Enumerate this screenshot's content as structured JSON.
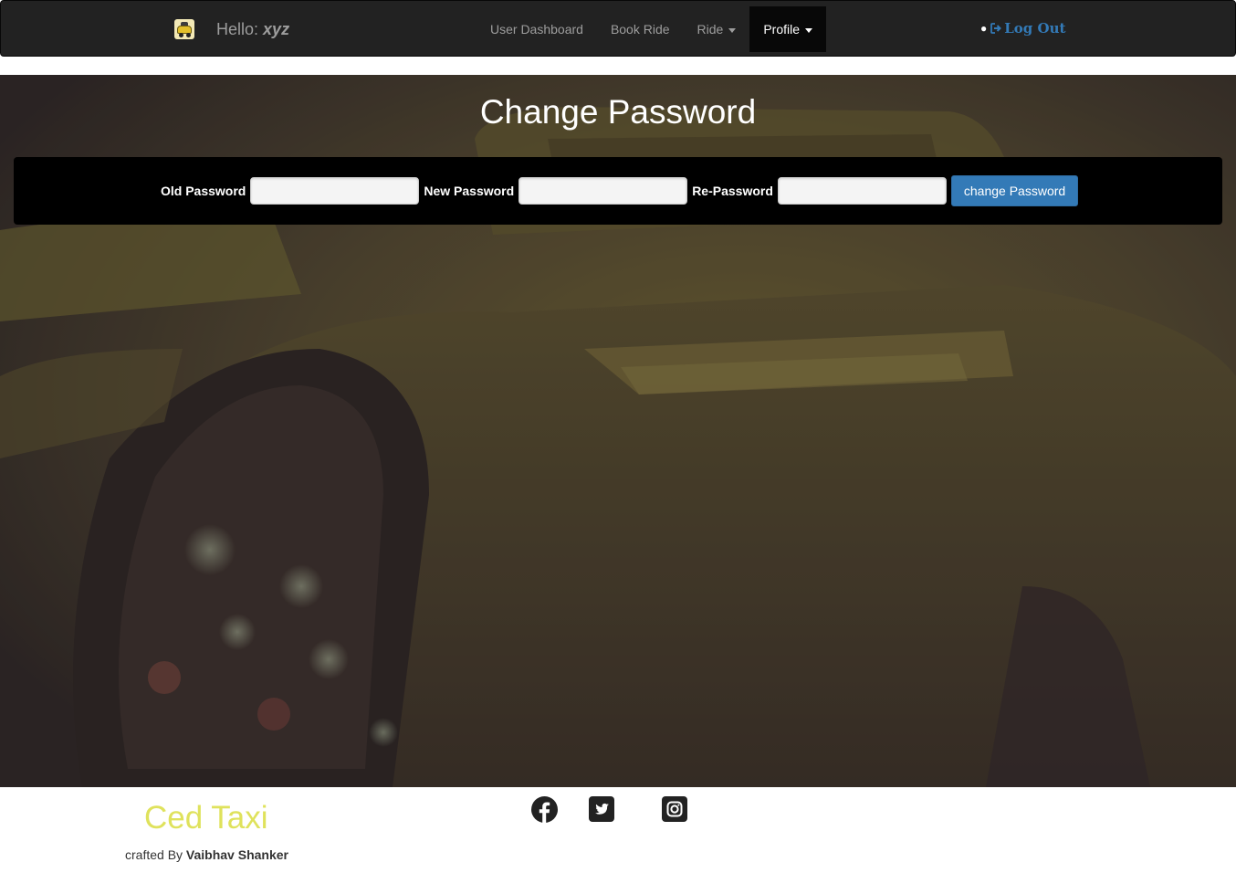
{
  "navbar": {
    "logo_icon": "taxi-logo-icon",
    "greeting": "Hello:",
    "username": "xyz",
    "links": [
      {
        "label": "User Dashboard",
        "dropdown": false,
        "active": false
      },
      {
        "label": "Book Ride",
        "dropdown": false,
        "active": false
      },
      {
        "label": "Ride",
        "dropdown": true,
        "active": false
      },
      {
        "label": "Profile",
        "dropdown": true,
        "active": true
      }
    ],
    "logout_label": "Log Out",
    "logout_icon": "sign-out-icon"
  },
  "main": {
    "title": "Change Password",
    "form": {
      "old_password_label": "Old Password",
      "old_password_value": "",
      "new_password_label": "New Password",
      "new_password_value": "",
      "re_password_label": "Re-Password",
      "re_password_value": "",
      "submit_label": "change Password"
    }
  },
  "footer": {
    "brand": "Ced Taxi",
    "credit_prefix": "crafted By",
    "author": "Vaibhav Shanker",
    "social_icons": [
      "facebook-icon",
      "twitter-icon",
      "instagram-icon"
    ]
  },
  "colors": {
    "navbar_bg": "#222222",
    "link_blue": "#337ab7",
    "brand_yellow": "#dfe25c"
  }
}
